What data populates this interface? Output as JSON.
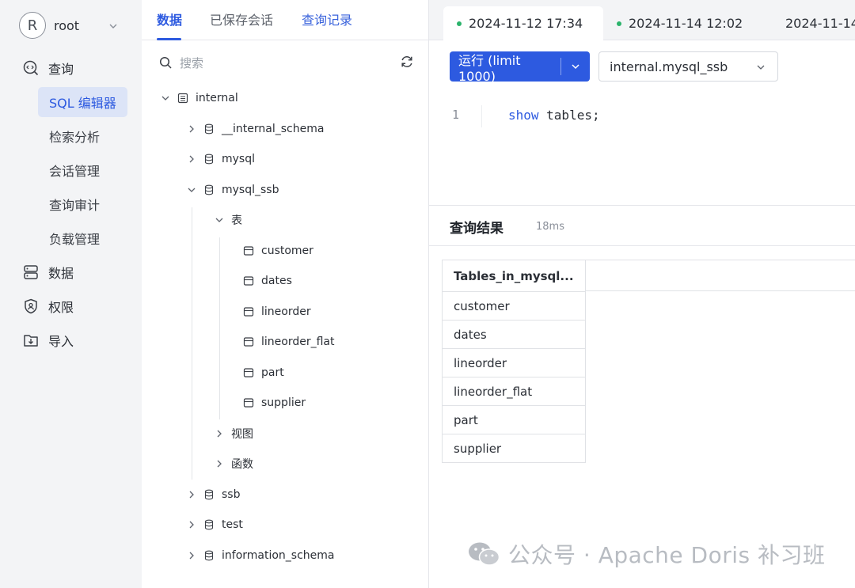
{
  "user": {
    "avatar_letter": "R",
    "name": "root"
  },
  "nav": {
    "query": "查询",
    "sub_items": [
      "SQL 编辑器",
      "检索分析",
      "会话管理",
      "查询审计",
      "负载管理"
    ],
    "data": "数据",
    "permissions": "权限",
    "import": "导入"
  },
  "panel": {
    "tabs": [
      "数据",
      "已保存会话",
      "查询记录"
    ],
    "search_placeholder": "搜索",
    "tree": {
      "catalog": "internal",
      "databases_before": [
        "__internal_schema",
        "mysql"
      ],
      "open_db": "mysql_ssb",
      "tables_group": "表",
      "tables": [
        "customer",
        "dates",
        "lineorder",
        "lineorder_flat",
        "part",
        "supplier"
      ],
      "views_group": "视图",
      "functions_group": "函数",
      "databases_after": [
        "ssb",
        "test",
        "information_schema"
      ]
    }
  },
  "editor": {
    "tabs": [
      "2024-11-12 17:34",
      "2024-11-14 12:02",
      "2024-11-14"
    ],
    "run_label": "运行 (limit 1000)",
    "database": "internal.mysql_ssb",
    "line_number": "1",
    "code_keyword": "show",
    "code_rest": " tables;",
    "result_title": "查询结果",
    "result_time": "18ms",
    "result_columns": [
      "Tables_in_mysql..."
    ],
    "result_rows": [
      "customer",
      "dates",
      "lineorder",
      "lineorder_flat",
      "part",
      "supplier"
    ]
  },
  "watermark": "公众号 · Apache Doris 补习班",
  "colors": {
    "accent": "#2d5ae0",
    "active_nav_bg": "#dce4f7",
    "status_dot": "#2bb36b"
  }
}
